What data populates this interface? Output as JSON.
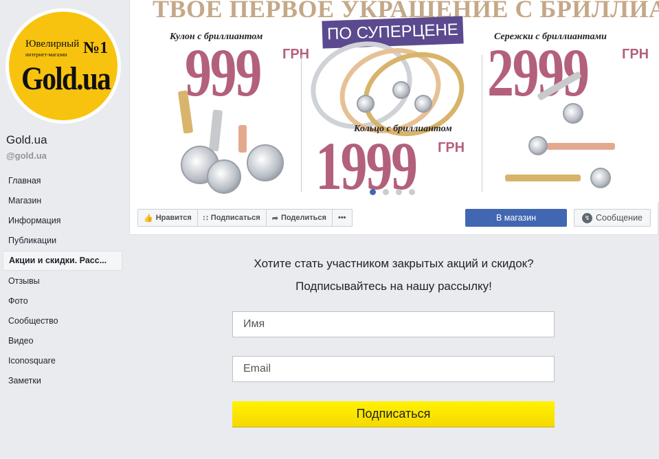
{
  "page": {
    "name": "Gold.ua",
    "handle": "@gold.ua"
  },
  "logo": {
    "line1": "Ювелирный",
    "line2": "интернет-магазин",
    "number": "№1",
    "brand": "Gold.ua",
    "bg_color": "#f8c30f"
  },
  "nav": {
    "items": [
      {
        "label": "Главная",
        "active": false
      },
      {
        "label": "Магазин",
        "active": false
      },
      {
        "label": "Информация",
        "active": false
      },
      {
        "label": "Публикации",
        "active": false
      },
      {
        "label": "Акции и скидки. Расс...",
        "active": true
      },
      {
        "label": "Отзывы",
        "active": false
      },
      {
        "label": "Фото",
        "active": false
      },
      {
        "label": "Сообщество",
        "active": false
      },
      {
        "label": "Видео",
        "active": false
      },
      {
        "label": "Iconosquare",
        "active": false
      },
      {
        "label": "Заметки",
        "active": false
      }
    ]
  },
  "cover": {
    "headline": "ТВОЕ ПЕРВОЕ УКРАШЕНИЕ С БРИЛЛИАНТОМ",
    "ribbon": "ПО СУПЕРЦЕНЕ",
    "pendant_label": "Кулон с бриллиантом",
    "pendant_price": "999",
    "earrings_label": "Сережки с бриллиантами",
    "earrings_price": "2999",
    "ring_label": "Кольцо с бриллиантом",
    "ring_price": "1999",
    "currency": "ГРН",
    "slides_total": 4,
    "slide_active": 1,
    "price_color": "#b3607d",
    "ribbon_color": "#5b4a8f"
  },
  "actions": {
    "like": "Нравится",
    "follow": "Подписаться",
    "share": "Поделиться",
    "more": "•••",
    "shop": "В магазин",
    "message": "Сообщение",
    "shop_color": "#4267b2"
  },
  "form": {
    "question": "Хотите стать участником закрытых акций и скидок?",
    "subtitle": "Подписывайтесь на нашу рассылку!",
    "name_placeholder": "Имя",
    "email_placeholder": "Email",
    "submit": "Подписаться",
    "submit_color": "#fff200"
  }
}
